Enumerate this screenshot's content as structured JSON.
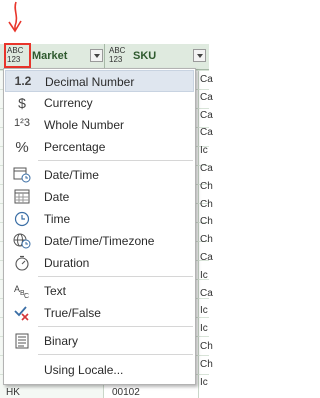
{
  "columns": [
    {
      "type_badge_top": "ABC",
      "type_badge_bottom": "123",
      "name": "Market"
    },
    {
      "type_badge_top": "ABC",
      "type_badge_bottom": "123",
      "name": "SKU"
    }
  ],
  "menu": {
    "items": [
      {
        "label": "Decimal Number",
        "icon": "decimal-icon",
        "glyph": "1.2"
      },
      {
        "label": "Currency",
        "icon": "currency-icon",
        "glyph": "$"
      },
      {
        "label": "Whole Number",
        "icon": "whole-number-icon",
        "glyph": "1²3"
      },
      {
        "label": "Percentage",
        "icon": "percentage-icon",
        "glyph": "%"
      },
      {
        "label": "Date/Time",
        "icon": "datetime-icon"
      },
      {
        "label": "Date",
        "icon": "date-icon"
      },
      {
        "label": "Time",
        "icon": "time-icon"
      },
      {
        "label": "Date/Time/Timezone",
        "icon": "datetime-timezone-icon"
      },
      {
        "label": "Duration",
        "icon": "duration-icon"
      },
      {
        "label": "Text",
        "icon": "text-icon"
      },
      {
        "label": "True/False",
        "icon": "true-false-icon"
      },
      {
        "label": "Binary",
        "icon": "binary-icon"
      },
      {
        "label": "Using Locale...",
        "icon": ""
      }
    ]
  },
  "grid": {
    "col2_fragments": [
      "Ca",
      "Ca",
      "Ca",
      "Ca",
      "Ic",
      "Ca",
      "Ch",
      "Ch",
      "Ch",
      "Ch",
      "Ca",
      "Ic",
      "Ca",
      "Ic",
      "Ic",
      "Ch",
      "Ch",
      "Ic"
    ],
    "bottom_row": {
      "market": "HK",
      "sku": "00102"
    }
  },
  "colors": {
    "annotation": "#e8352b",
    "header_bg": "#dfeadf",
    "header_text": "#2f5a2f",
    "highlight": "#dfe6ef"
  }
}
